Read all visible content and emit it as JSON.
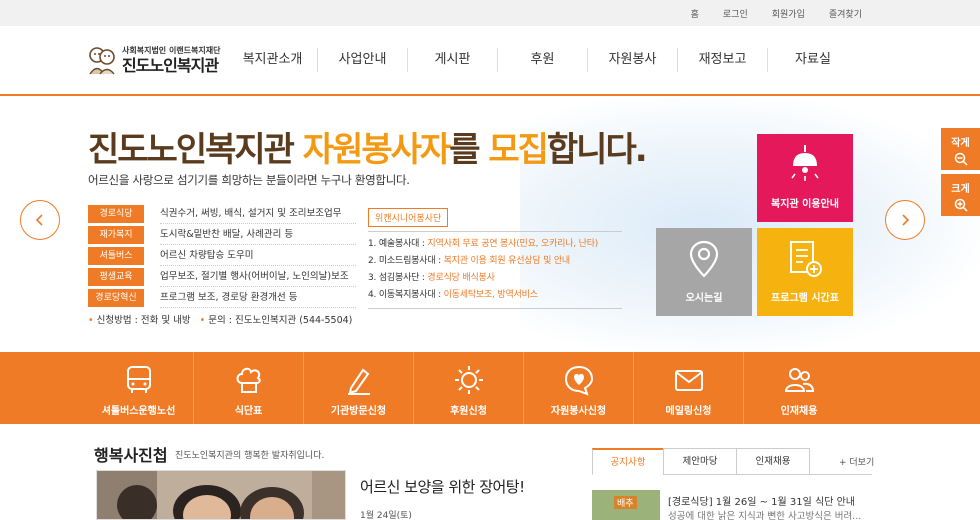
{
  "topbar": {
    "links": [
      "홈",
      "로그인",
      "회원가입",
      "즐겨찾기"
    ]
  },
  "header": {
    "logo_small": "사회복지법인 이랜드복지재단",
    "logo_big": "진도노인복지관",
    "nav": [
      "복지관소개",
      "사업안내",
      "게시판",
      "후원",
      "자원봉사",
      "재정보고",
      "자료실"
    ]
  },
  "banner": {
    "headline_a": "진도노인복지관 ",
    "headline_b": "자원봉사자",
    "headline_c": "를 ",
    "headline_d": "모집",
    "headline_e": "합니다.",
    "subline": "어르신을 사랑으로 섬기기를 희망하는 분들이라면 누구나 환영합니다.",
    "tasks": [
      {
        "tag": "경로식당",
        "desc": "식권수거, 써빙, 배식, 설거지 및 조리보조업무"
      },
      {
        "tag": "재가복지",
        "desc": "도시락&밑반찬 배달, 사례관리 등"
      },
      {
        "tag": "셔틀버스",
        "desc": "어르신 차량탑승 도우미"
      },
      {
        "tag": "평생교육",
        "desc": "업무보조, 절기별 행사(어버이날, 노인의날)보조"
      },
      {
        "tag": "경로당혁신",
        "desc": "프로그램 보조, 경로당 환경개선 등"
      }
    ],
    "apply_a_label": "신청방법",
    "apply_a_value": "전화 및 내방",
    "apply_b_label": "문의",
    "apply_b_value": "진도노인복지관 (544-5504)",
    "senior_title": "위캔시니어봉사단",
    "senior_rows": [
      {
        "name": "1. 예술봉사대",
        "desc": "지역사회 무료 공연 봉사(민요, 오카리나, 난타)"
      },
      {
        "name": "2. 미소드림봉사대",
        "desc": "복지관 이용 회원 유선상담 및 안내"
      },
      {
        "name": "3. 섬김봉사단",
        "desc": "경로식당 배식봉사"
      },
      {
        "name": "4. 이동복지봉사대",
        "desc": "이동세탁보조, 방역서비스"
      }
    ],
    "quick_buttons": [
      {
        "label": "복지관 이용안내",
        "icon": "lamp-icon",
        "color": "#e4185a"
      },
      {
        "label": "오시는길",
        "icon": "map-pin-icon",
        "color": "#a6a6a6"
      },
      {
        "label": "프로그램 시간표",
        "icon": "schedule-doc-icon",
        "color": "#f6b20f"
      }
    ]
  },
  "font_control": {
    "smaller": "작게",
    "larger": "크게"
  },
  "quick_menu": [
    {
      "label": "셔틀버스운행노선",
      "icon": "bus-icon"
    },
    {
      "label": "식단표",
      "icon": "chef-hat-icon"
    },
    {
      "label": "기관방문신청",
      "icon": "pencil-icon"
    },
    {
      "label": "후원신청",
      "icon": "sun-icon"
    },
    {
      "label": "자원봉사신청",
      "icon": "heart-bubble-icon"
    },
    {
      "label": "메일링신청",
      "icon": "mail-icon"
    },
    {
      "label": "인재채용",
      "icon": "people-icon"
    }
  ],
  "happy": {
    "title": "행복사진첩",
    "subtitle": "진도노인복지관의 행복한 발자취입니다.",
    "article_title": "어르신 보양을 위한 장어탕!",
    "article_date": "1월 24일(토)"
  },
  "board": {
    "tabs": [
      "공지사항",
      "제안마당",
      "인재채용"
    ],
    "more": "+ 더보기",
    "thumb_text": "배추",
    "notice_title": "[경로식당] 1월 26일 ~ 1월 31일 식단 안내",
    "notice_desc": "성공에 대한 낡은 지식과 뻔한 사고방식은 버려..."
  },
  "colors": {
    "accent": "#f07b26",
    "brown": "#5a3b1e",
    "gold": "#f39a12",
    "pink": "#e4185a",
    "gray": "#a6a6a6",
    "yellow": "#f6b20f"
  }
}
